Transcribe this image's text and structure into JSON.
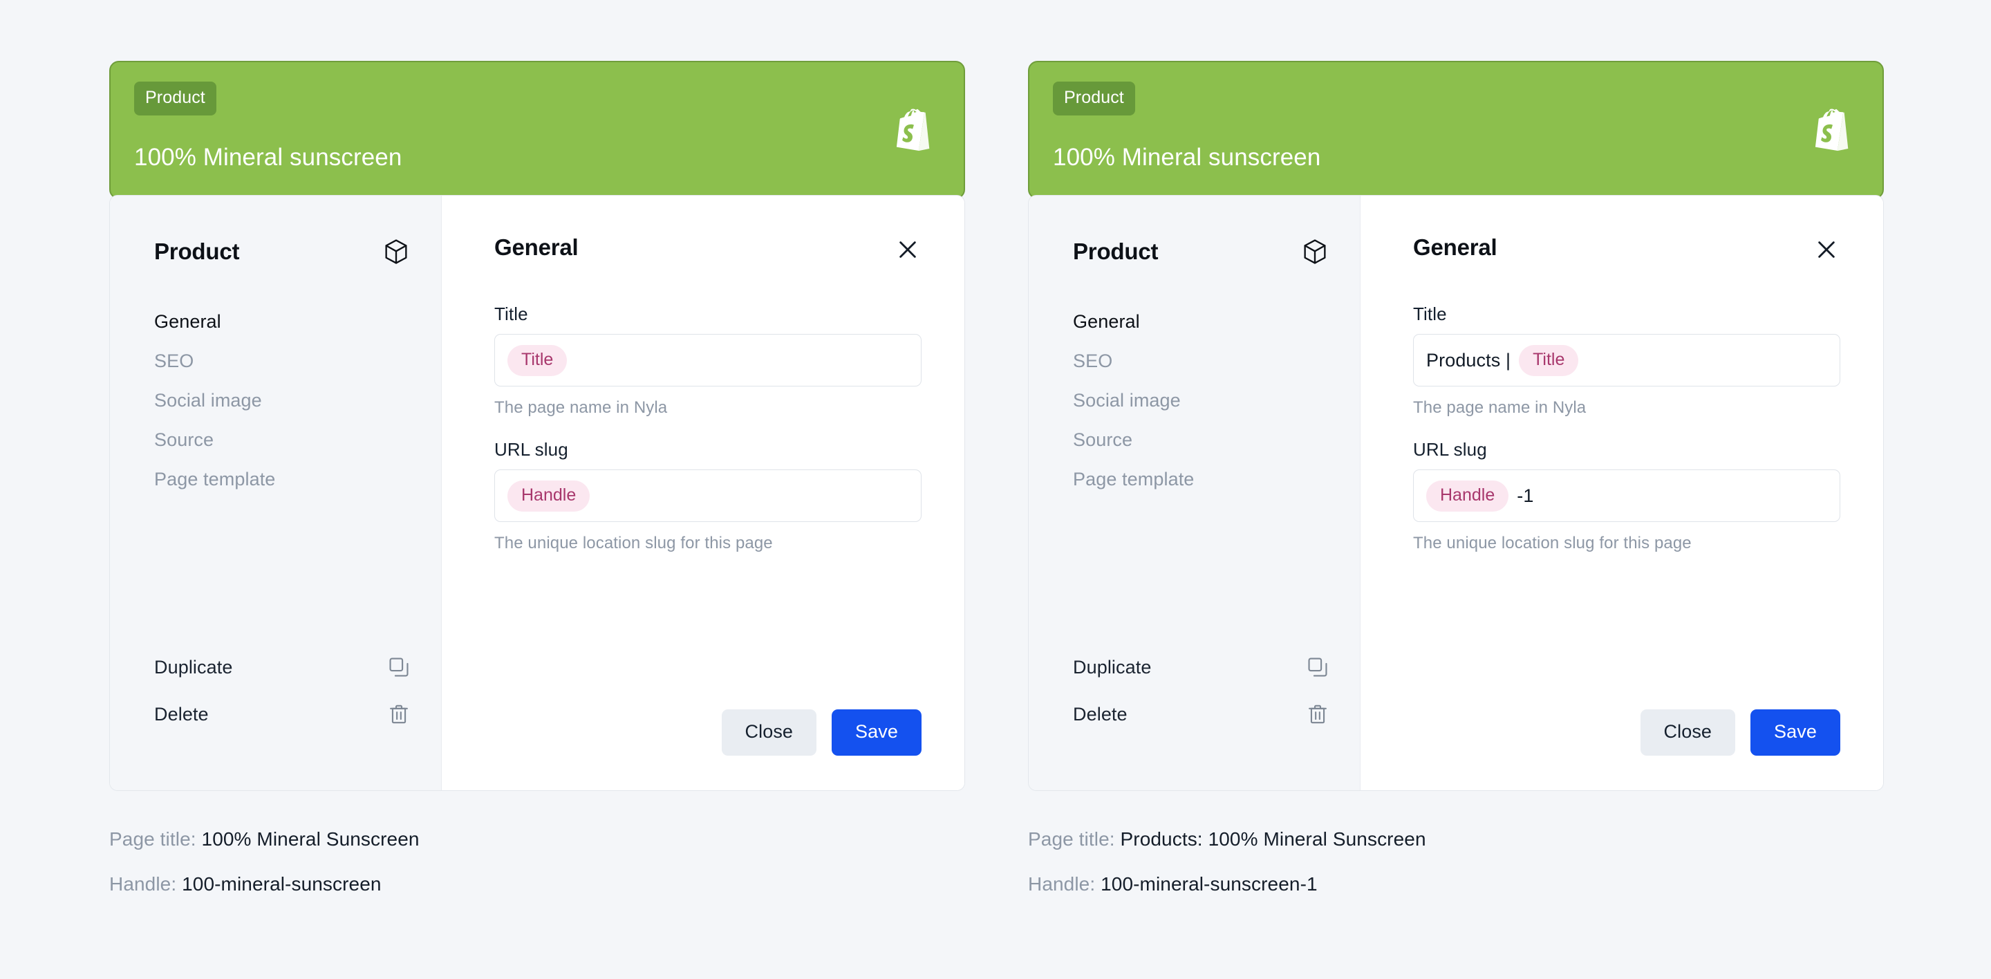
{
  "page": {
    "background_color": "#f4f6f9"
  },
  "colors": {
    "green_header": "#8cbf4d",
    "green_border": "#6f9d3a",
    "green_badge": "#67993a",
    "chip_bg": "#fbe7f0",
    "chip_text": "#a8376c",
    "save_blue": "#1451ef",
    "close_gray": "#e9edf2",
    "sidebar_bg": "#f4f6f9",
    "muted_text": "#8d97a5"
  },
  "cards": [
    {
      "id": "left",
      "header": {
        "badge": "Product",
        "title": "100% Mineral sunscreen",
        "logo_icon": "shopify-bag-icon"
      },
      "sidebar": {
        "heading": "Product",
        "heading_icon": "cube-icon",
        "items": [
          {
            "label": "General",
            "active": true
          },
          {
            "label": "SEO",
            "active": false
          },
          {
            "label": "Social image",
            "active": false
          },
          {
            "label": "Source",
            "active": false
          },
          {
            "label": "Page template",
            "active": false
          }
        ],
        "actions": [
          {
            "label": "Duplicate",
            "icon": "copy-icon"
          },
          {
            "label": "Delete",
            "icon": "trash-icon"
          }
        ]
      },
      "pane": {
        "heading": "General",
        "close_icon": "close-icon",
        "fields": [
          {
            "label": "Title",
            "prefix": "",
            "chip": "Title",
            "suffix": "",
            "helper": "The page name in Nyla"
          },
          {
            "label": "URL slug",
            "prefix": "",
            "chip": "Handle",
            "suffix": "",
            "helper": "The unique location slug for this page"
          }
        ],
        "buttons": {
          "close": "Close",
          "save": "Save"
        }
      },
      "captions": [
        {
          "key": "Page title:",
          "value": "100% Mineral Sunscreen"
        },
        {
          "key": "Handle:",
          "value": "100-mineral-sunscreen"
        }
      ]
    },
    {
      "id": "right",
      "header": {
        "badge": "Product",
        "title": "100% Mineral sunscreen",
        "logo_icon": "shopify-bag-icon"
      },
      "sidebar": {
        "heading": "Product",
        "heading_icon": "cube-icon",
        "items": [
          {
            "label": "General",
            "active": true
          },
          {
            "label": "SEO",
            "active": false
          },
          {
            "label": "Social image",
            "active": false
          },
          {
            "label": "Source",
            "active": false
          },
          {
            "label": "Page template",
            "active": false
          }
        ],
        "actions": [
          {
            "label": "Duplicate",
            "icon": "copy-icon"
          },
          {
            "label": "Delete",
            "icon": "trash-icon"
          }
        ]
      },
      "pane": {
        "heading": "General",
        "close_icon": "close-icon",
        "fields": [
          {
            "label": "Title",
            "prefix": "Products |",
            "chip": "Title",
            "suffix": "",
            "helper": "The page name in Nyla"
          },
          {
            "label": "URL slug",
            "prefix": "",
            "chip": "Handle",
            "suffix": "-1",
            "helper": "The unique location slug for this page"
          }
        ],
        "buttons": {
          "close": "Close",
          "save": "Save"
        }
      },
      "captions": [
        {
          "key": "Page title:",
          "value": "Products: 100% Mineral Sunscreen"
        },
        {
          "key": "Handle:",
          "value": "100-mineral-sunscreen-1"
        }
      ]
    }
  ]
}
